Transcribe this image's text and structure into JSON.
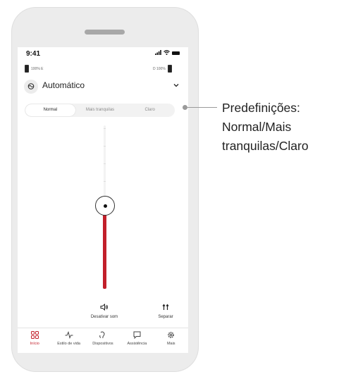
{
  "status_bar": {
    "time": "9:41",
    "signal_icon": "signal-icon",
    "wifi_icon": "wifi-icon",
    "battery_icon": "battery-icon"
  },
  "hearing_aids": {
    "left_label": "100% E",
    "right_label": "D 100%"
  },
  "program": {
    "title": "Automático",
    "icon": "loop-icon",
    "chevron": "⌄"
  },
  "presets": {
    "items": [
      "Normal",
      "Mais tranquilas",
      "Claro"
    ],
    "selected": "Normal"
  },
  "volume": {
    "level": 0.55
  },
  "actions": {
    "mute_label": "Desativar som",
    "split_label": "Separar"
  },
  "nav": {
    "items": [
      {
        "label": "Início",
        "icon": "grid-icon",
        "active": true
      },
      {
        "label": "Estilo de vida",
        "icon": "activity-icon",
        "active": false
      },
      {
        "label": "Dispositivos",
        "icon": "hearing-aid-icon",
        "active": false
      },
      {
        "label": "Assistência",
        "icon": "chat-icon",
        "active": false
      },
      {
        "label": "Mais",
        "icon": "gear-icon",
        "active": false
      }
    ]
  },
  "callout": {
    "text": "Predefinições: Normal/Mais tranquilas/Claro"
  },
  "colors": {
    "accent": "#c21f2a"
  }
}
